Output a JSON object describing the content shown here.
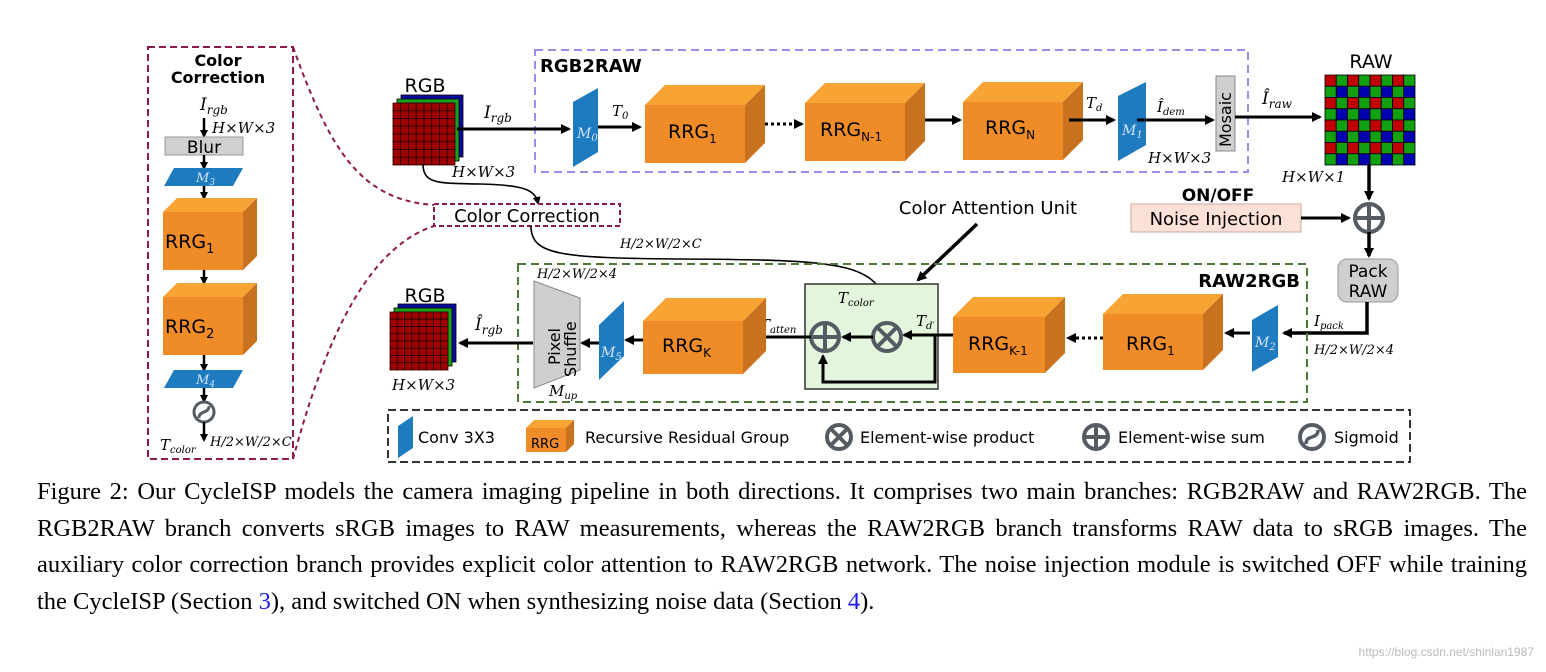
{
  "colors": {
    "rrg_front": "#f08c28",
    "rrg_top": "#f8a435",
    "rrg_side": "#c8721f",
    "conv": "#1f7bbf",
    "rgb2raw_border": "#9b8cf0",
    "raw2rgb_border": "#4a7a35",
    "color_corr_border": "#8b1a50",
    "attention_fill": "#e3f5dc",
    "noise_fill": "#fde0d8",
    "op_gray": "#555b63"
  },
  "left_panel": {
    "title_line1": "Color",
    "title_line2": "Correction",
    "input": {
      "main": "I",
      "sub": "rgb"
    },
    "dims": "H×W×3",
    "blur": "Blur",
    "conv_a": {
      "main": "M",
      "sub": "3"
    },
    "rrg1": {
      "main": "RRG",
      "sub": "1"
    },
    "rrg2": {
      "main": "RRG",
      "sub": "2"
    },
    "conv_b": {
      "main": "M",
      "sub": "4"
    },
    "sigmoid_icon": "sigmoid-icon",
    "output": {
      "main": "T",
      "sub": "color"
    },
    "output_dims": "H/2×W/2×C"
  },
  "rgb2raw": {
    "title": "RGB2RAW",
    "input_label": "RGB",
    "input_arrow": {
      "main": "I",
      "sub": "rgb"
    },
    "input_dims": "H×W×3",
    "m0": {
      "main": "M",
      "sub": "0"
    },
    "t0": {
      "main": "T",
      "sub": "0"
    },
    "rrg1": {
      "main": "RRG",
      "sub": "1"
    },
    "rrgn1": {
      "main": "RRG",
      "sub": "N-1"
    },
    "rrgn": {
      "main": "RRG",
      "sub": "N"
    },
    "td": {
      "main": "T",
      "sub": "d"
    },
    "m1": {
      "main": "M",
      "sub": "1"
    },
    "i_dem": {
      "main": "Î",
      "sub": "dem"
    },
    "dims": "H×W×3",
    "mosaic": "Mosaic",
    "i_raw": {
      "main": "Î",
      "sub": "raw"
    },
    "output_label": "RAW",
    "output_dims": "H×W×1"
  },
  "noise": {
    "switch": "ON/OFF",
    "label": "Noise Injection"
  },
  "pack": {
    "line1": "Pack",
    "line2": "RAW",
    "i_pack": {
      "main": "I",
      "sub": "pack"
    },
    "dims": "H/2×W/2×4"
  },
  "color_correction_label": "Color Correction",
  "color_correction_dims": "H/2×W/2×C",
  "color_attention_label": "Color Attention Unit",
  "raw2rgb": {
    "title": "RAW2RGB",
    "m2": {
      "main": "M",
      "sub": "2"
    },
    "rrg1": {
      "main": "RRG",
      "sub": "1"
    },
    "rrgk1": {
      "main": "RRG",
      "sub": "K-1"
    },
    "td_prime": {
      "main": "T",
      "sub": "d′"
    },
    "t_color": {
      "main": "T",
      "sub": "color"
    },
    "t_atten": {
      "main": "T",
      "sub": "atten"
    },
    "rrgk": {
      "main": "RRG",
      "sub": "K"
    },
    "m5": {
      "main": "M",
      "sub": "5"
    },
    "pixel_shuffle_1": "Pixel",
    "pixel_shuffle_2": "Shuffle",
    "m_up": {
      "main": "M",
      "sub": "up"
    },
    "shuffle_dims": "H/2×W/2×4",
    "output_arrow": {
      "main": "Î",
      "sub": "rgb"
    },
    "output_label": "RGB",
    "output_dims": "H×W×3"
  },
  "legend": {
    "conv": "Conv 3X3",
    "rrg_icon_text": "RRG",
    "rrg": "Recursive Residual Group",
    "product": "Element-wise product",
    "sum": "Element-wise sum",
    "sigmoid": "Sigmoid"
  },
  "caption": {
    "part1": "Figure 2: Our CycleISP models the camera imaging pipeline in both directions. It comprises two main branches: RGB2RAW and RAW2RGB. The RGB2RAW branch converts sRGB images to RAW measurements, whereas the RAW2RGB branch transforms RAW data to sRGB images. The auxiliary color correction branch provides explicit color attention to RAW2RGB network.  The noise injection module is switched OFF while training the CycleISP (Section ",
    "ref1": "3",
    "part2": "), and switched ON when synthesizing noise data (Section ",
    "ref2": "4",
    "part3": ")."
  },
  "watermark": "https://blog.csdn.net/shinian1987"
}
